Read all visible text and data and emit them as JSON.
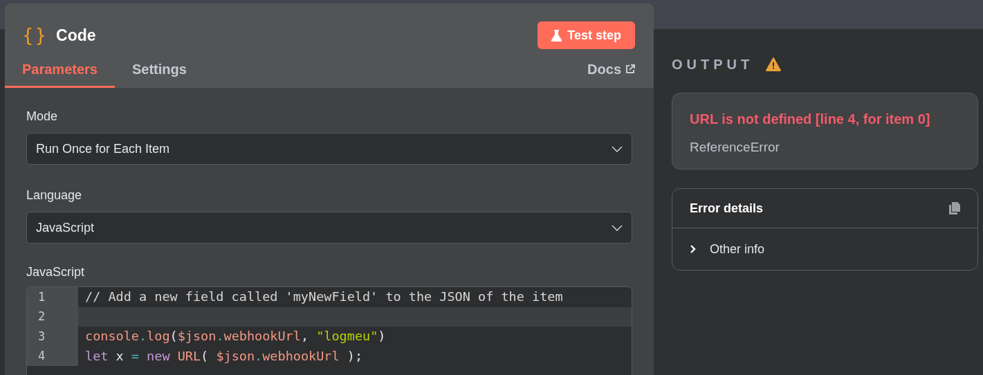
{
  "node": {
    "icon": "{}",
    "title": "Code",
    "test_button": "Test step"
  },
  "tabs": [
    {
      "label": "Parameters",
      "selected": true
    },
    {
      "label": "Settings",
      "selected": false
    }
  ],
  "docs_link": "Docs",
  "fields": [
    {
      "label": "Mode",
      "value": "Run Once for Each Item"
    },
    {
      "label": "Language",
      "value": "JavaScript"
    }
  ],
  "editor": {
    "label": "JavaScript",
    "lines": [
      {
        "number": "1",
        "selected": false,
        "tokens": [
          {
            "kind": "comment",
            "text": "// Add a new field called 'myNewField' to the JSON of the item"
          }
        ]
      },
      {
        "number": "2",
        "selected": true
      },
      {
        "number": "3",
        "selected": false,
        "tokens": [
          {
            "kind": "name",
            "text": "console"
          },
          {
            "kind": "operator",
            "text": "."
          },
          {
            "kind": "name",
            "text": "log"
          },
          {
            "kind": "plain",
            "text": "("
          },
          {
            "kind": "name",
            "text": "$json"
          },
          {
            "kind": "operator",
            "text": "."
          },
          {
            "kind": "name",
            "text": "webhookUrl"
          },
          {
            "kind": "plain",
            "text": ", "
          },
          {
            "kind": "string",
            "text": "\"logmeu\""
          },
          {
            "kind": "plain",
            "text": ")"
          }
        ]
      },
      {
        "number": "4",
        "selected": false,
        "tokens": [
          {
            "kind": "keyword",
            "text": "let"
          },
          {
            "kind": "plain",
            "text": " x "
          },
          {
            "kind": "operator",
            "text": "="
          },
          {
            "kind": "keyword",
            "text": " new"
          },
          {
            "kind": "name",
            "text": " URL"
          },
          {
            "kind": "plain",
            "text": "( "
          },
          {
            "kind": "name",
            "text": "$json"
          },
          {
            "kind": "operator",
            "text": "."
          },
          {
            "kind": "name",
            "text": "webhookUrl"
          },
          {
            "kind": "plain",
            "text": " );"
          }
        ]
      }
    ]
  },
  "output": {
    "heading": "OUTPUT",
    "error": {
      "message": "URL is not defined [line 4, for item 0]",
      "type": "ReferenceError"
    },
    "details": {
      "title": "Error details",
      "sections": [
        {
          "label": "Other info",
          "expanded": false
        }
      ]
    }
  }
}
